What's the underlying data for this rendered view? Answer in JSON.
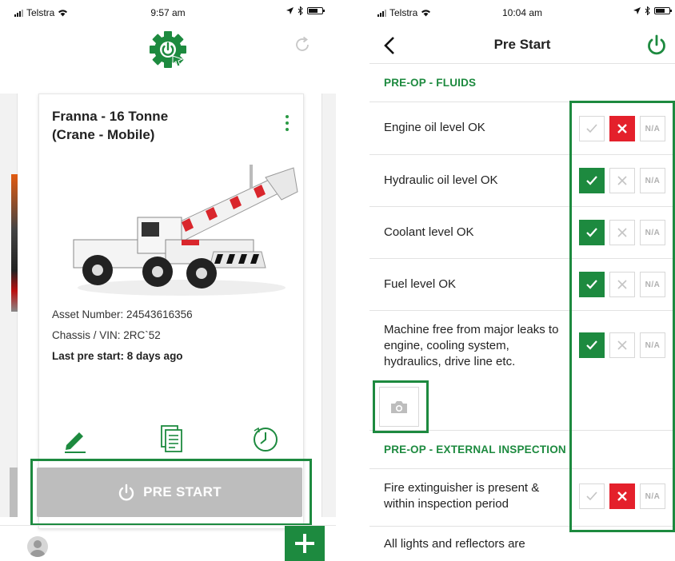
{
  "left_screen": {
    "status_bar": {
      "carrier": "Telstra",
      "time": "9:57 am"
    },
    "asset_card": {
      "title_line1": "Franna - 16 Tonne",
      "title_line2": "(Crane - Mobile)",
      "asset_number": "Asset Number: 24543616356",
      "chassis": "Chassis / VIN: 2RC`52",
      "last_prestart": "Last pre start: 8 days ago"
    },
    "prestart_button": "PRE START"
  },
  "right_screen": {
    "status_bar": {
      "carrier": "Telstra",
      "time": "10:04 am"
    },
    "nav_title": "Pre Start",
    "sections": [
      {
        "label": "PRE-OP - FLUIDS"
      },
      {
        "label": "PRE-OP - EXTERNAL INSPECTION"
      }
    ],
    "checks": [
      {
        "text": "Engine oil level OK",
        "state": "fail"
      },
      {
        "text": "Hydraulic oil level OK",
        "state": "pass"
      },
      {
        "text": "Coolant level OK",
        "state": "pass"
      },
      {
        "text": "Fuel level OK",
        "state": "pass"
      },
      {
        "text_line1": "Machine free from major leaks to",
        "text_line2": "engine, cooling system,",
        "text_line3": "hydraulics, drive line etc.",
        "state": "pass"
      },
      {
        "text_line1": "Fire extinguisher is present &",
        "text_line2": "within inspection period",
        "state": "fail"
      },
      {
        "text": "All lights and reflectors are"
      }
    ],
    "na_label": "N/A"
  },
  "colors": {
    "brand_green": "#1d8a3f",
    "fail_red": "#e4202b",
    "disabled_gray": "#bdbdbd"
  },
  "icons": [
    "gear-power-logo-icon",
    "refresh-icon",
    "kebab-menu-icon",
    "edit-pencil-icon",
    "documents-icon",
    "history-clock-icon",
    "power-icon",
    "plus-icon",
    "avatar-icon",
    "back-chevron-icon",
    "check-icon",
    "cross-icon",
    "camera-icon"
  ]
}
